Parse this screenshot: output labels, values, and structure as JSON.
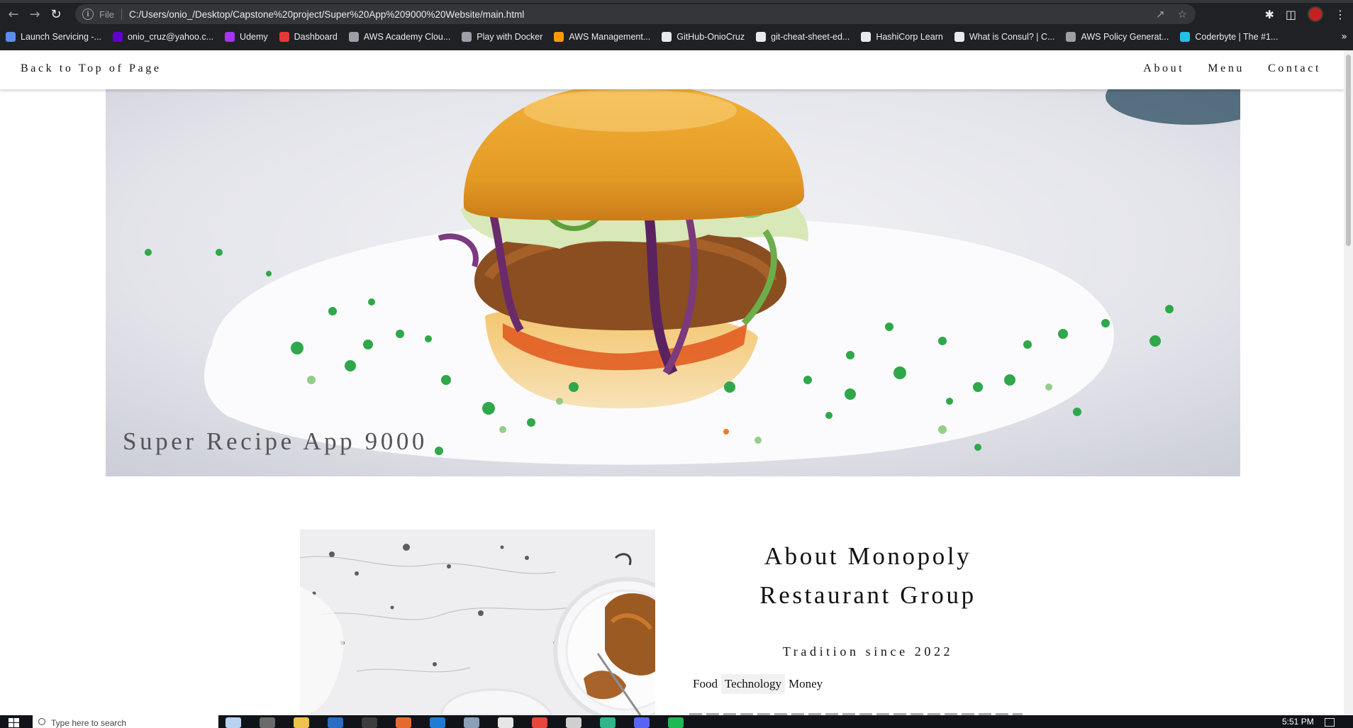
{
  "browser": {
    "file_label": "File",
    "url": "C:/Users/onio_/Desktop/Capstone%20project/Super%20App%209000%20Website/main.html",
    "bookmarks": [
      {
        "label": "Launch Servicing -...",
        "color": "#5b8def"
      },
      {
        "label": "onio_cruz@yahoo.c...",
        "color": "#6001d2"
      },
      {
        "label": "Udemy",
        "color": "#a435f0"
      },
      {
        "label": "Dashboard",
        "color": "#e53935"
      },
      {
        "label": "AWS Academy Clou...",
        "color": "#9aa0a6"
      },
      {
        "label": "Play with Docker",
        "color": "#9aa0a6"
      },
      {
        "label": "AWS Management...",
        "color": "#ff9900"
      },
      {
        "label": "GitHub-OnioCruz",
        "color": "#e8eaed"
      },
      {
        "label": "git-cheat-sheet-ed...",
        "color": "#e8eaed"
      },
      {
        "label": "HashiCorp Learn",
        "color": "#e8eaed"
      },
      {
        "label": "What is Consul? | C...",
        "color": "#e8eaed"
      },
      {
        "label": "AWS Policy Generat...",
        "color": "#9aa0a6"
      },
      {
        "label": "Coderbyte | The #1...",
        "color": "#1ec3e6"
      }
    ],
    "more_label": "»"
  },
  "site": {
    "nav": {
      "back_to_top": "Back to Top of Page",
      "links": [
        "About",
        "Menu",
        "Contact"
      ]
    },
    "hero": {
      "title": "Super Recipe App 9000"
    },
    "about": {
      "title_line1": "About Monopoly",
      "title_line2": "Restaurant Group",
      "subtitle": "Tradition since 2022",
      "tags": [
        "Food",
        "Technology",
        "Money"
      ],
      "active_tag": "Technology"
    }
  },
  "taskbar": {
    "search_placeholder": "Type here to search",
    "time": "5:51 PM"
  },
  "colors": {
    "chrome_bg": "#202124",
    "omnibox_bg": "#35363a",
    "page_bg": "#ffffff",
    "text": "#111111"
  }
}
